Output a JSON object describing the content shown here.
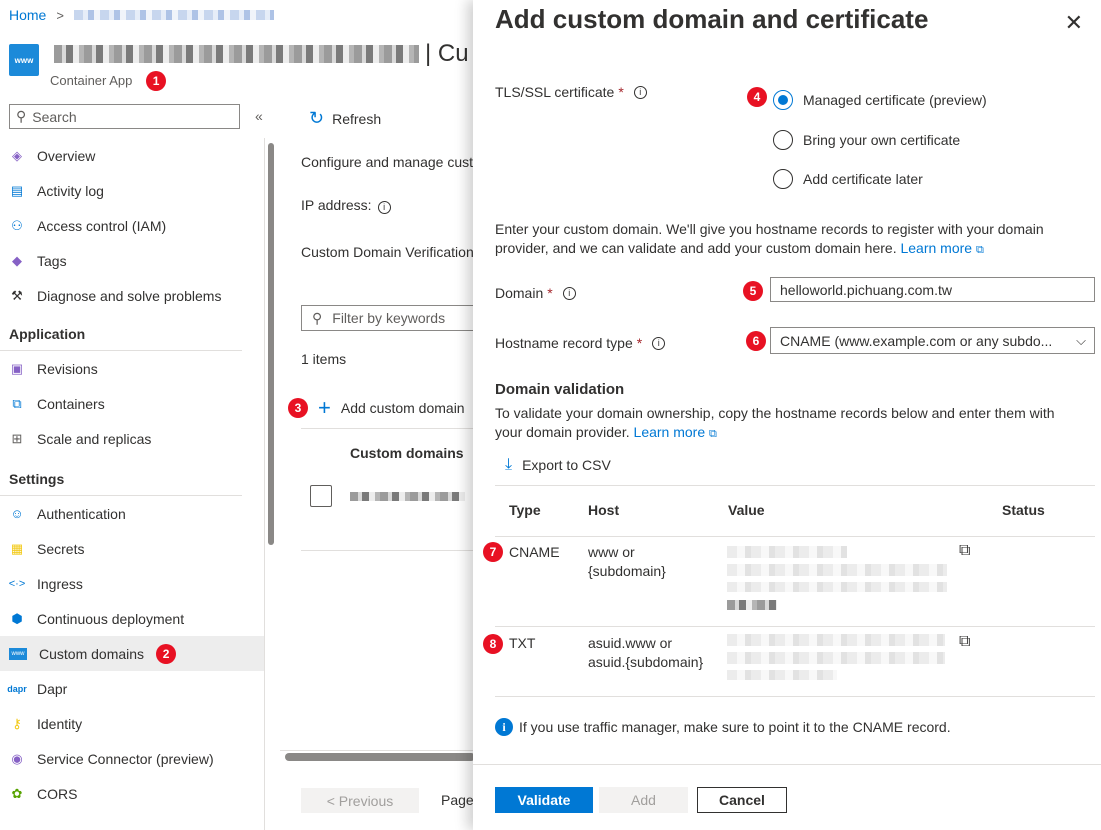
{
  "breadcrumb": {
    "home": "Home",
    "separator": ">"
  },
  "resource": {
    "title_suffix": "| Cu",
    "type_label": "Container App"
  },
  "badges": [
    "1",
    "2",
    "3",
    "4",
    "5",
    "6",
    "7",
    "8"
  ],
  "sidebar": {
    "search_placeholder": "Search",
    "collapse": "«",
    "items_top": [
      {
        "label": "Overview",
        "icon": "overview-icon"
      },
      {
        "label": "Activity log",
        "icon": "activity-log-icon"
      },
      {
        "label": "Access control (IAM)",
        "icon": "iam-icon"
      },
      {
        "label": "Tags",
        "icon": "tag-icon"
      },
      {
        "label": "Diagnose and solve problems",
        "icon": "wrench-icon"
      }
    ],
    "section_application": "Application",
    "items_application": [
      {
        "label": "Revisions",
        "icon": "revisions-icon"
      },
      {
        "label": "Containers",
        "icon": "containers-icon"
      },
      {
        "label": "Scale and replicas",
        "icon": "scale-icon"
      }
    ],
    "section_settings": "Settings",
    "items_settings": [
      {
        "label": "Authentication",
        "icon": "authentication-icon"
      },
      {
        "label": "Secrets",
        "icon": "secrets-icon"
      },
      {
        "label": "Ingress",
        "icon": "ingress-icon"
      },
      {
        "label": "Continuous deployment",
        "icon": "deployment-icon"
      },
      {
        "label": "Custom domains",
        "icon": "www-icon"
      },
      {
        "label": "Dapr",
        "icon": "dapr-icon"
      },
      {
        "label": "Identity",
        "icon": "identity-icon"
      },
      {
        "label": "Service Connector (preview)",
        "icon": "service-connector-icon"
      },
      {
        "label": "CORS",
        "icon": "cors-icon"
      }
    ]
  },
  "middle": {
    "refresh": "Refresh",
    "configure_text": "Configure and manage cust",
    "ip_address": "IP address:",
    "verification": "Custom Domain Verification",
    "filter_placeholder": "Filter by keywords",
    "items_count": "1 items",
    "add_custom_domain": "Add custom domain",
    "col_custom_domains": "Custom domains",
    "prev": "< Previous",
    "page": "Page"
  },
  "panel": {
    "title": "Add custom domain and certificate",
    "close": "✕",
    "tls_label": "TLS/SSL certificate",
    "tls_options": [
      "Managed certificate (preview)",
      "Bring your own certificate",
      "Add certificate later"
    ],
    "tls_selected": 0,
    "description": "Enter your custom domain. We'll give you hostname records to register with your domain provider, and we can validate and add your custom domain here.",
    "learn_more": "Learn more",
    "domain_label": "Domain",
    "domain_value": "helloworld.pichuang.com.tw",
    "hostname_label": "Hostname record type",
    "hostname_value": "CNAME (www.example.com or any subdo...",
    "validation_heading": "Domain validation",
    "validation_desc": "To validate your domain ownership, copy the hostname records below and enter them with your domain provider.",
    "export_csv": "Export to CSV",
    "table_headers": [
      "Type",
      "Host",
      "Value",
      "Status"
    ],
    "rows": [
      {
        "type": "CNAME",
        "host_line1": "www or",
        "host_line2": "{subdomain}"
      },
      {
        "type": "TXT",
        "host_line1": "asuid.www or",
        "host_line2": "asuid.{subdomain}"
      }
    ],
    "note": "If you use traffic manager, make sure to point it to the CNAME record.",
    "btn_validate": "Validate",
    "btn_add": "Add",
    "btn_cancel": "Cancel"
  },
  "colors": {
    "accent": "#0078d4",
    "badge": "#e81123"
  }
}
